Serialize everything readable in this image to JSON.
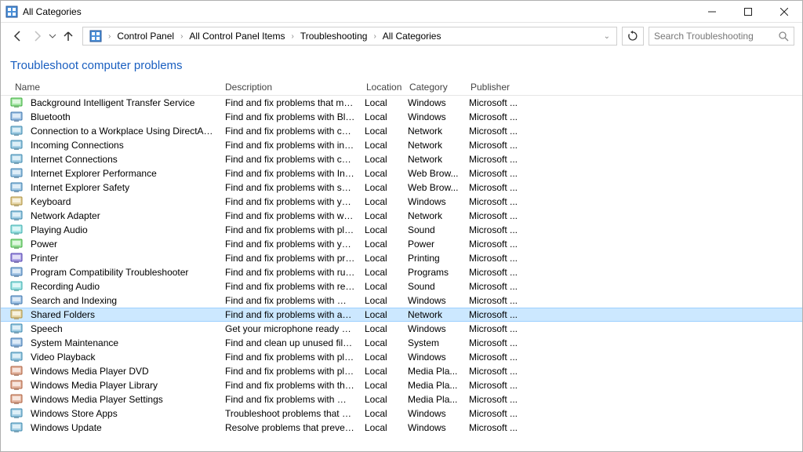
{
  "window": {
    "title": "All Categories"
  },
  "breadcrumb": {
    "seg0": "Control Panel",
    "seg1": "All Control Panel Items",
    "seg2": "Troubleshooting",
    "seg3": "All Categories"
  },
  "search": {
    "placeholder": "Search Troubleshooting"
  },
  "heading": "Troubleshoot computer problems",
  "columns": {
    "name": "Name",
    "description": "Description",
    "location": "Location",
    "category": "Category",
    "publisher": "Publisher"
  },
  "selected_index": 15,
  "items": [
    {
      "name": "Background Intelligent Transfer Service",
      "desc": "Find and fix problems that may p...",
      "loc": "Local",
      "cat": "Windows",
      "pub": "Microsoft ...",
      "hue": 120
    },
    {
      "name": "Bluetooth",
      "desc": "Find and fix problems with Blueto...",
      "loc": "Local",
      "cat": "Windows",
      "pub": "Microsoft ...",
      "hue": 210
    },
    {
      "name": "Connection to a Workplace Using DirectAccess",
      "desc": "Find and fix problems with conne...",
      "loc": "Local",
      "cat": "Network",
      "pub": "Microsoft ...",
      "hue": 200
    },
    {
      "name": "Incoming Connections",
      "desc": "Find and fix problems with incom...",
      "loc": "Local",
      "cat": "Network",
      "pub": "Microsoft ...",
      "hue": 200
    },
    {
      "name": "Internet Connections",
      "desc": "Find and fix problems with conne...",
      "loc": "Local",
      "cat": "Network",
      "pub": "Microsoft ...",
      "hue": 200
    },
    {
      "name": "Internet Explorer Performance",
      "desc": "Find and fix problems with Intern...",
      "loc": "Local",
      "cat": "Web Brow...",
      "pub": "Microsoft ...",
      "hue": 205
    },
    {
      "name": "Internet Explorer Safety",
      "desc": "Find and fix problems with securi...",
      "loc": "Local",
      "cat": "Web Brow...",
      "pub": "Microsoft ...",
      "hue": 205
    },
    {
      "name": "Keyboard",
      "desc": "Find and fix problems with your c...",
      "loc": "Local",
      "cat": "Windows",
      "pub": "Microsoft ...",
      "hue": 45
    },
    {
      "name": "Network Adapter",
      "desc": "Find and fix problems with wirele...",
      "loc": "Local",
      "cat": "Network",
      "pub": "Microsoft ...",
      "hue": 200
    },
    {
      "name": "Playing Audio",
      "desc": "Find and fix problems with playin...",
      "loc": "Local",
      "cat": "Sound",
      "pub": "Microsoft ...",
      "hue": 180
    },
    {
      "name": "Power",
      "desc": "Find and fix problems with your c...",
      "loc": "Local",
      "cat": "Power",
      "pub": "Microsoft ...",
      "hue": 120
    },
    {
      "name": "Printer",
      "desc": "Find and fix problems with printi...",
      "loc": "Local",
      "cat": "Printing",
      "pub": "Microsoft ...",
      "hue": 250
    },
    {
      "name": "Program Compatibility Troubleshooter",
      "desc": "Find and fix problems with runni...",
      "loc": "Local",
      "cat": "Programs",
      "pub": "Microsoft ...",
      "hue": 210
    },
    {
      "name": "Recording Audio",
      "desc": "Find and fix problems with record...",
      "loc": "Local",
      "cat": "Sound",
      "pub": "Microsoft ...",
      "hue": 180
    },
    {
      "name": "Search and Indexing",
      "desc": "Find and fix problems with Wind...",
      "loc": "Local",
      "cat": "Windows",
      "pub": "Microsoft ...",
      "hue": 210
    },
    {
      "name": "Shared Folders",
      "desc": "Find and fix problems with access...",
      "loc": "Local",
      "cat": "Network",
      "pub": "Microsoft ...",
      "hue": 45
    },
    {
      "name": "Speech",
      "desc": "Get your microphone ready and f...",
      "loc": "Local",
      "cat": "Windows",
      "pub": "Microsoft ...",
      "hue": 200
    },
    {
      "name": "System Maintenance",
      "desc": "Find and clean up unused files an...",
      "loc": "Local",
      "cat": "System",
      "pub": "Microsoft ...",
      "hue": 210
    },
    {
      "name": "Video Playback",
      "desc": "Find and fix problems with playin...",
      "loc": "Local",
      "cat": "Windows",
      "pub": "Microsoft ...",
      "hue": 200
    },
    {
      "name": "Windows Media Player DVD",
      "desc": "Find and fix problems with playin...",
      "loc": "Local",
      "cat": "Media Pla...",
      "pub": "Microsoft ...",
      "hue": 18
    },
    {
      "name": "Windows Media Player Library",
      "desc": "Find and fix problems with the Wi...",
      "loc": "Local",
      "cat": "Media Pla...",
      "pub": "Microsoft ...",
      "hue": 18
    },
    {
      "name": "Windows Media Player Settings",
      "desc": "Find and fix problems with Wind...",
      "loc": "Local",
      "cat": "Media Pla...",
      "pub": "Microsoft ...",
      "hue": 18
    },
    {
      "name": "Windows Store Apps",
      "desc": "Troubleshoot problems that may ...",
      "loc": "Local",
      "cat": "Windows",
      "pub": "Microsoft ...",
      "hue": 200
    },
    {
      "name": "Windows Update",
      "desc": "Resolve problems that prevent yo...",
      "loc": "Local",
      "cat": "Windows",
      "pub": "Microsoft ...",
      "hue": 200
    }
  ]
}
